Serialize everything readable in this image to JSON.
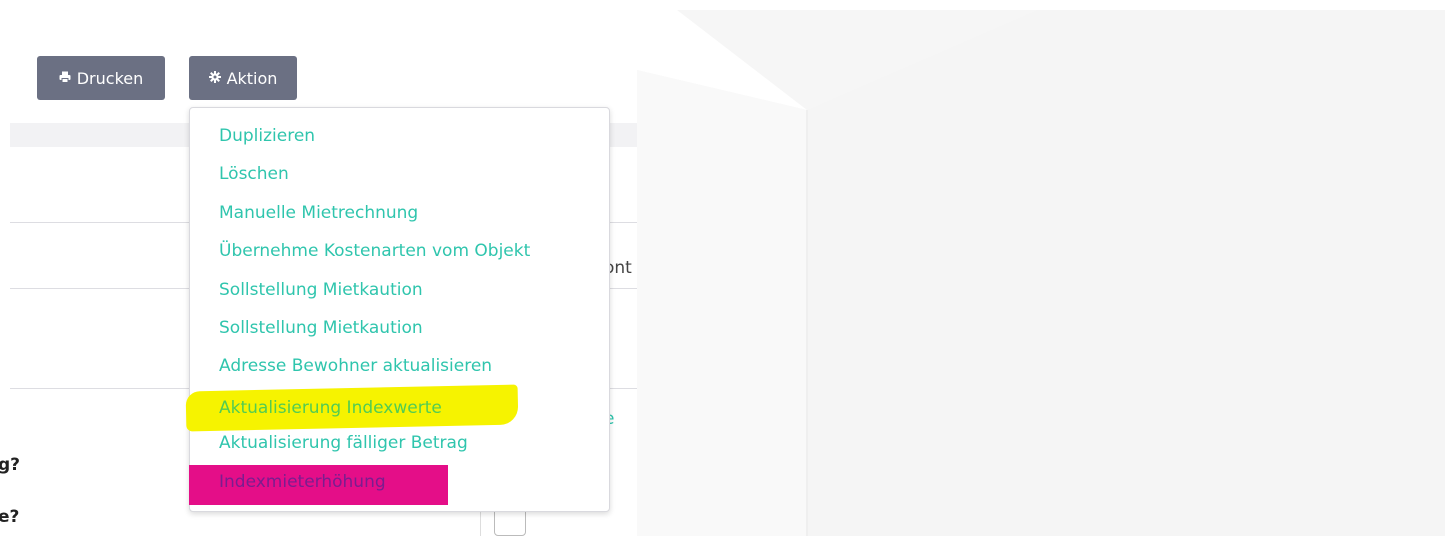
{
  "toolbar": {
    "print_label": "Drucken",
    "print_icon": "print-icon",
    "action_label": "Aktion",
    "action_icon": "gear-icon"
  },
  "menu": {
    "items": [
      {
        "label": "Duplizieren"
      },
      {
        "label": "Löschen"
      },
      {
        "label": "Manuelle Mietrechnung"
      },
      {
        "label": "Übernehme Kostenarten vom Objekt"
      },
      {
        "label": "Sollstellung Mietkaution"
      },
      {
        "label": "Sollstellung Mietkaution"
      },
      {
        "label": "Adresse Bewohner aktualisieren"
      },
      {
        "label": "Aktualisierung Indexwerte",
        "highlight": "#f6f300"
      },
      {
        "label": "Aktualisierung fälliger Betrag"
      },
      {
        "label": "Indexmieterhöhung",
        "highlight": "#e40e88"
      }
    ]
  },
  "background": {
    "fragment_ont": "ont",
    "fragment_e": "e",
    "fragment_g": "g?",
    "fragment_e2": "e?"
  },
  "colors": {
    "link": "#2fc5ad",
    "button": "#6b7083",
    "yellow_highlight": "#f6f300",
    "magenta_highlight": "#e40e88"
  }
}
